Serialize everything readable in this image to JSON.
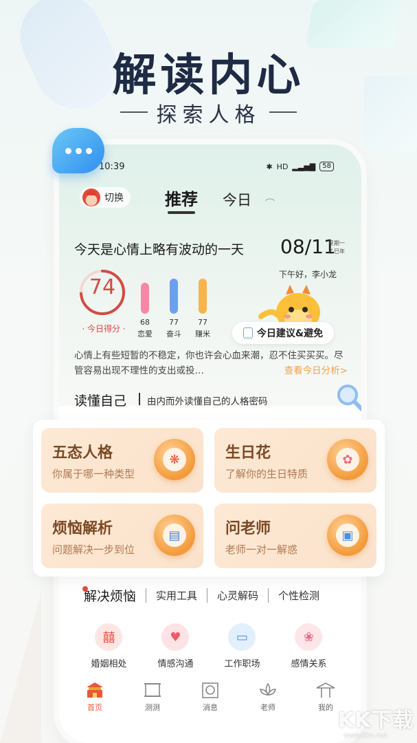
{
  "promo": {
    "headline": "解读内心",
    "subline": "探索人格"
  },
  "status_bar": {
    "time": "10:39",
    "icons": [
      "bluetooth-icon",
      "hd-icon",
      "signal-icon"
    ],
    "battery": "58"
  },
  "header": {
    "switch_label": "切换",
    "tabs": [
      {
        "label": "推荐",
        "active": true
      },
      {
        "label": "今日",
        "active": false
      }
    ]
  },
  "daily": {
    "mood_title": "今天是心情上略有波动的一天",
    "date": "08/11",
    "weekday": "星期一",
    "year_label": "乙巳年",
    "score": "74",
    "score_fraction": 0.74,
    "score_label": "· 今日得分 ·",
    "meters": [
      {
        "value": "68",
        "name": "恋爱",
        "level": 0.68,
        "color": "#f28aa6"
      },
      {
        "value": "77",
        "name": "奋斗",
        "level": 0.77,
        "color": "#6c9ff0"
      },
      {
        "value": "77",
        "name": "赚米",
        "level": 0.77,
        "color": "#f7b34c"
      }
    ],
    "greeting": "下午好，李小龙",
    "advice_label": "今日建议&避免",
    "description": "心情上有些短暂的不稳定，你也许会心血来潮，忍不住买买买。尽管容易出现不理性的支出或投…",
    "more_link": "查看今日分析>"
  },
  "read_self": {
    "title": "读懂自己",
    "subtitle": "由内而外读懂自己的人格密码"
  },
  "feature_cards": [
    {
      "title": "五态人格",
      "subtitle": "你属于哪一种类型",
      "icon": "mask-icon"
    },
    {
      "title": "生日花",
      "subtitle": "了解你的生日特质",
      "icon": "flower-icon"
    },
    {
      "title": "烦恼解析",
      "subtitle": "问题解决一步到位",
      "icon": "notebook-icon"
    },
    {
      "title": "问老师",
      "subtitle": "老师一对一解惑",
      "icon": "chat-icon"
    }
  ],
  "section_tabs": [
    "解决烦恼",
    "实用工具",
    "心灵解码",
    "个性检测"
  ],
  "quick_items": [
    {
      "label": "婚姻相处",
      "icon": "marriage-icon",
      "bg": "#fde6e3",
      "fg": "#e45446"
    },
    {
      "label": "情感沟通",
      "icon": "heart-icon",
      "bg": "#fde3e6",
      "fg": "#ef5a6a"
    },
    {
      "label": "工作职场",
      "icon": "briefcase-icon",
      "bg": "#e2effd",
      "fg": "#4a90e2"
    },
    {
      "label": "感情关系",
      "icon": "flower-icon",
      "bg": "#fde6ea",
      "fg": "#ee6b80"
    }
  ],
  "bottom_nav": [
    {
      "label": "首页",
      "icon": "palace-icon",
      "active": true
    },
    {
      "label": "测测",
      "icon": "scroll-icon",
      "active": false
    },
    {
      "label": "消息",
      "icon": "gong-icon",
      "active": false
    },
    {
      "label": "老师",
      "icon": "lotus-icon",
      "active": false
    },
    {
      "label": "我的",
      "icon": "pavilion-icon",
      "active": false
    }
  ],
  "watermark": {
    "text": "KK下载",
    "url": "www.kkx.net"
  }
}
